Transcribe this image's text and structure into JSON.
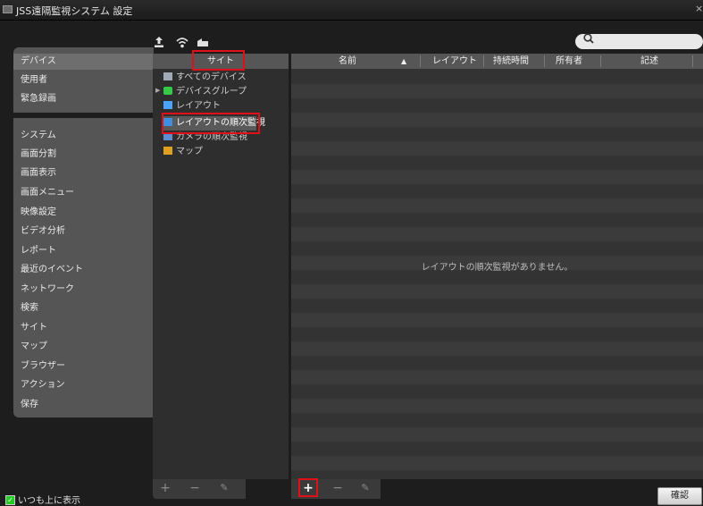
{
  "window": {
    "title": "JSS遠隔監視システム 設定"
  },
  "nav": {
    "items": [
      "デバイス",
      "使用者",
      "緊急録画",
      "システム",
      "画面分割",
      "画面表示",
      "画面メニュー",
      "映像設定",
      "ビデオ分析",
      "レポート",
      "最近のイベント",
      "ネットワーク",
      "検索",
      "サイト",
      "マップ",
      "ブラウザー",
      "アクション",
      "保存"
    ],
    "selected": "デバイス"
  },
  "toolbar": {
    "icons": [
      "upload-icon",
      "wireless-icon",
      "sd-card-icon"
    ]
  },
  "search": {
    "placeholder": ""
  },
  "tree": {
    "header": "サイト",
    "items": [
      {
        "label": "すべてのデバイス",
        "icon": "all-devices-icon",
        "color": "#9fa9b8"
      },
      {
        "label": "デバイスグループ",
        "icon": "device-group-icon",
        "color": "#33cc44"
      },
      {
        "label": "レイアウト",
        "icon": "layout-icon",
        "color": "#4aa3ff"
      },
      {
        "label": "レイアウトの順次監視",
        "icon": "layout-sequence-icon",
        "color": "#3f8fe0"
      },
      {
        "label": "カメラの順次監視",
        "icon": "camera-sequence-icon",
        "color": "#5b8fd0"
      },
      {
        "label": "マップ",
        "icon": "map-icon",
        "color": "#e0a020"
      }
    ],
    "selected": "レイアウトの順次監視"
  },
  "list": {
    "columns": [
      "名前",
      "レイアウト",
      "持続時間",
      "所有者",
      "記述"
    ],
    "sort_indicator": "▲",
    "empty_message": "レイアウトの順次監視がありません。"
  },
  "bottom": {
    "tree_buttons": [
      "+",
      "−",
      "✎"
    ],
    "list_buttons": [
      "+",
      "−",
      "✎"
    ],
    "always_on_top_label": "いつも上に表示",
    "always_on_top_checked": true,
    "ok_label": "確認"
  },
  "colors": {
    "highlight": "#e0101a",
    "accent_green": "#22cc22"
  }
}
